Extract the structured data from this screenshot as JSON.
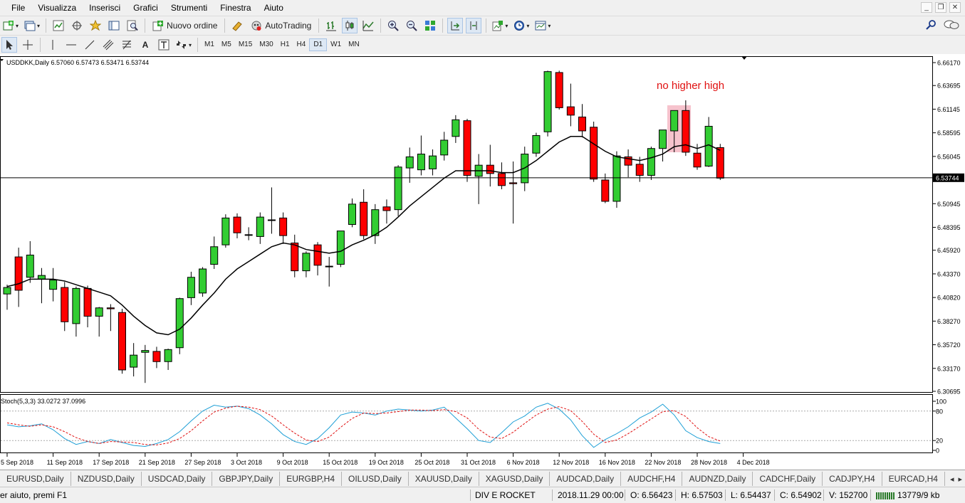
{
  "menu": [
    "File",
    "Visualizza",
    "Inserisci",
    "Grafici",
    "Strumenti",
    "Finestra",
    "Aiuto"
  ],
  "toolbar": {
    "new_order": "Nuovo ordine",
    "autotrading": "AutoTrading"
  },
  "drawing_tools": {
    "text_tool": "A"
  },
  "timeframes": [
    "M1",
    "M5",
    "M15",
    "M30",
    "H1",
    "H4",
    "D1",
    "W1",
    "MN"
  ],
  "active_timeframe": "D1",
  "chart": {
    "symbol_info": "USDDKK,Daily  6.57060 6.57473 6.53471 6.53744",
    "annotation": "no higher high",
    "current_price_label": "6.53744",
    "price_ticks": [
      "6.66170",
      "6.63695",
      "6.61145",
      "6.58595",
      "6.56045",
      "6.53744",
      "6.50945",
      "6.48395",
      "6.45920",
      "6.43370",
      "6.40820",
      "6.38270",
      "6.35720",
      "6.33170",
      "6.30695"
    ],
    "stoch_label": "Stoch(5,3,3) 33.0272 37.0996",
    "stoch_ticks": [
      "100",
      "80",
      "20",
      "0"
    ],
    "date_ticks": [
      "5 Sep 2018",
      "11 Sep 2018",
      "17 Sep 2018",
      "21 Sep 2018",
      "27 Sep 2018",
      "3 Oct 2018",
      "9 Oct 2018",
      "15 Oct 2018",
      "19 Oct 2018",
      "25 Oct 2018",
      "31 Oct 2018",
      "6 Nov 2018",
      "12 Nov 2018",
      "16 Nov 2018",
      "22 Nov 2018",
      "28 Nov 2018",
      "4 Dec 2018"
    ],
    "colors": {
      "bull": "#32cd32",
      "bear": "#ff0000",
      "ma": "#000000",
      "stoch_main": "#1e9fd6",
      "stoch_signal": "#e01010",
      "highlight": "#f4b4c0",
      "annotation": "#e01010"
    }
  },
  "chart_data": {
    "type": "candlestick",
    "ohlc": [
      [
        6.412,
        6.422,
        6.395,
        6.419
      ],
      [
        6.452,
        6.462,
        6.398,
        6.416
      ],
      [
        6.43,
        6.469,
        6.424,
        6.454
      ],
      [
        6.428,
        6.44,
        6.402,
        6.432
      ],
      [
        6.417,
        6.44,
        6.404,
        6.427
      ],
      [
        6.419,
        6.425,
        6.372,
        6.382
      ],
      [
        6.38,
        6.42,
        6.366,
        6.418
      ],
      [
        6.418,
        6.421,
        6.376,
        6.388
      ],
      [
        6.388,
        6.398,
        6.366,
        6.397
      ],
      [
        6.397,
        6.401,
        6.372,
        6.396
      ],
      [
        6.392,
        6.396,
        6.326,
        6.33
      ],
      [
        6.333,
        6.359,
        6.323,
        6.346
      ],
      [
        6.349,
        6.357,
        6.316,
        6.351
      ],
      [
        6.35,
        6.355,
        6.332,
        6.339
      ],
      [
        6.339,
        6.353,
        6.33,
        6.352
      ],
      [
        6.354,
        6.408,
        6.347,
        6.407
      ],
      [
        6.408,
        6.436,
        6.4,
        6.43
      ],
      [
        6.413,
        6.441,
        6.409,
        6.439
      ],
      [
        6.444,
        6.474,
        6.439,
        6.463
      ],
      [
        6.465,
        6.498,
        6.462,
        6.494
      ],
      [
        6.495,
        6.499,
        6.472,
        6.478
      ],
      [
        6.476,
        6.484,
        6.47,
        6.476
      ],
      [
        6.474,
        6.5,
        6.466,
        6.495
      ],
      [
        6.492,
        6.527,
        6.477,
        6.492
      ],
      [
        6.494,
        6.5,
        6.466,
        6.475
      ],
      [
        6.467,
        6.476,
        6.43,
        6.437
      ],
      [
        6.437,
        6.458,
        6.43,
        6.456
      ],
      [
        6.465,
        6.468,
        6.432,
        6.443
      ],
      [
        6.442,
        6.452,
        6.42,
        6.442
      ],
      [
        6.444,
        6.48,
        6.441,
        6.48
      ],
      [
        6.487,
        6.515,
        6.484,
        6.509
      ],
      [
        6.511,
        6.525,
        6.471,
        6.475
      ],
      [
        6.475,
        6.509,
        6.466,
        6.503
      ],
      [
        6.506,
        6.514,
        6.488,
        6.502
      ],
      [
        6.503,
        6.551,
        6.496,
        6.549
      ],
      [
        6.548,
        6.57,
        6.532,
        6.56
      ],
      [
        6.546,
        6.583,
        6.54,
        6.563
      ],
      [
        6.547,
        6.568,
        6.54,
        6.561
      ],
      [
        6.562,
        6.587,
        6.556,
        6.578
      ],
      [
        6.582,
        6.605,
        6.575,
        6.6
      ],
      [
        6.599,
        6.601,
        6.533,
        6.54
      ],
      [
        6.539,
        6.563,
        6.509,
        6.551
      ],
      [
        6.551,
        6.573,
        6.528,
        6.542
      ],
      [
        6.542,
        6.554,
        6.525,
        6.529
      ],
      [
        6.532,
        6.555,
        6.488,
        6.531
      ],
      [
        6.532,
        6.571,
        6.523,
        6.563
      ],
      [
        6.564,
        6.586,
        6.56,
        6.583
      ],
      [
        6.587,
        6.653,
        6.582,
        6.652
      ],
      [
        6.651,
        6.653,
        6.611,
        6.613
      ],
      [
        6.614,
        6.639,
        6.593,
        6.605
      ],
      [
        6.603,
        6.617,
        6.581,
        6.588
      ],
      [
        6.592,
        6.598,
        6.533,
        6.536
      ],
      [
        6.535,
        6.542,
        6.51,
        6.512
      ],
      [
        6.512,
        6.566,
        6.505,
        6.561
      ],
      [
        6.56,
        6.568,
        6.538,
        6.551
      ],
      [
        6.552,
        6.56,
        6.533,
        6.54
      ],
      [
        6.54,
        6.571,
        6.535,
        6.569
      ],
      [
        6.569,
        6.589,
        6.555,
        6.589
      ],
      [
        6.588,
        6.6,
        6.565,
        6.61
      ],
      [
        6.61,
        6.621,
        6.561,
        6.565
      ],
      [
        6.564,
        6.574,
        6.546,
        6.549
      ],
      [
        6.55,
        6.603,
        6.549,
        6.593
      ],
      [
        6.57,
        6.574,
        6.535,
        6.537
      ]
    ],
    "ma": [
      6.42,
      6.423,
      6.428,
      6.428,
      6.428,
      6.426,
      6.422,
      6.418,
      6.414,
      6.41,
      6.4,
      6.388,
      6.378,
      6.37,
      6.368,
      6.374,
      6.386,
      6.4,
      6.413,
      6.428,
      6.439,
      6.447,
      6.455,
      6.463,
      6.467,
      6.465,
      6.46,
      6.458,
      6.456,
      6.458,
      6.465,
      6.47,
      6.476,
      6.484,
      6.495,
      6.507,
      6.517,
      6.527,
      6.537,
      6.545,
      6.545,
      6.545,
      6.545,
      6.543,
      6.543,
      6.548,
      6.556,
      6.566,
      6.576,
      6.582,
      6.582,
      6.574,
      6.566,
      6.56,
      6.558,
      6.556,
      6.559,
      6.563,
      6.571,
      6.573,
      6.569,
      6.573,
      6.567
    ],
    "stoch_main": [
      52,
      48,
      50,
      54,
      42,
      24,
      12,
      18,
      14,
      22,
      16,
      10,
      8,
      14,
      22,
      38,
      60,
      80,
      92,
      88,
      90,
      85,
      72,
      54,
      32,
      18,
      12,
      24,
      46,
      72,
      78,
      76,
      72,
      80,
      84,
      82,
      80,
      82,
      88,
      66,
      44,
      20,
      16,
      36,
      58,
      70,
      88,
      96,
      84,
      62,
      30,
      6,
      22,
      34,
      48,
      66,
      78,
      94,
      72,
      40,
      26,
      18,
      14
    ],
    "stoch_signal": [
      56,
      52,
      49,
      52,
      48,
      38,
      26,
      18,
      14,
      18,
      17,
      16,
      12,
      11,
      15,
      24,
      40,
      60,
      78,
      86,
      90,
      88,
      83,
      70,
      52,
      35,
      21,
      18,
      27,
      47,
      65,
      76,
      75,
      76,
      79,
      82,
      82,
      81,
      83,
      79,
      66,
      43,
      27,
      24,
      37,
      55,
      72,
      84,
      89,
      81,
      59,
      33,
      16,
      21,
      34,
      49,
      64,
      79,
      81,
      69,
      46,
      28,
      19
    ]
  },
  "tabs": [
    "EURUSD,Daily",
    "NZDUSD,Daily",
    "USDCAD,Daily",
    "GBPJPY,Daily",
    "EURGBP,H4",
    "OILUSD,Daily",
    "XAUUSD,Daily",
    "XAGUSD,Daily",
    "AUDCAD,Daily",
    "AUDCHF,H4",
    "AUDNZD,Daily",
    "CADCHF,Daily",
    "CADJPY,H4",
    "EURCAD,H4"
  ],
  "status": {
    "help": "er aiuto, premi F1",
    "profile": "DIV E ROCKET",
    "datetime": "2018.11.29 00:00",
    "open": "O: 6.56423",
    "high": "H: 6.57503",
    "low": "L: 6.54437",
    "close": "C: 6.54902",
    "volume": "V: 152700",
    "traffic": "13779/9 kb"
  }
}
